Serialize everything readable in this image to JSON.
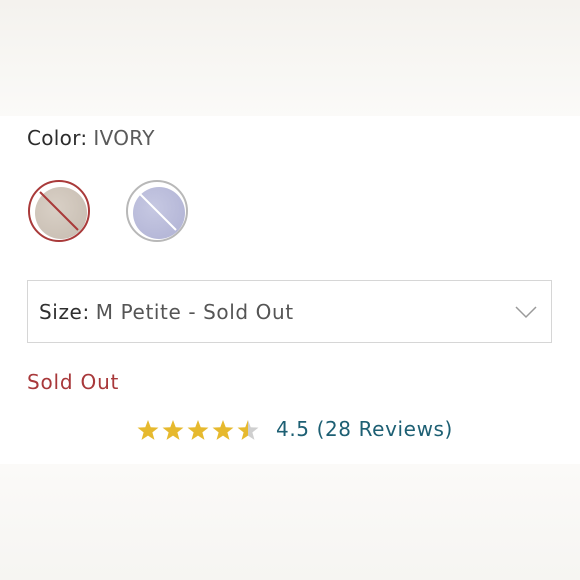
{
  "color": {
    "label": "Color:",
    "selected": "IVORY",
    "swatches": [
      {
        "name": "Ivory",
        "state": "selected",
        "sold_out": true,
        "fill": "#cbc1b6",
        "ring": "#a93a3a"
      },
      {
        "name": "Periwinkle",
        "state": "unselected",
        "sold_out": true,
        "fill": "#b6b8d8",
        "ring": "#b8b8b8"
      }
    ]
  },
  "size": {
    "label": "Size:",
    "selected": "M Petite - Sold Out"
  },
  "availability": {
    "status": "Sold Out",
    "color": "#a8383a"
  },
  "rating": {
    "value": 4.5,
    "max": 5,
    "text": "4.5 (28 Reviews)",
    "star_color": "#e6b92e",
    "link_color": "#1d5f73"
  }
}
